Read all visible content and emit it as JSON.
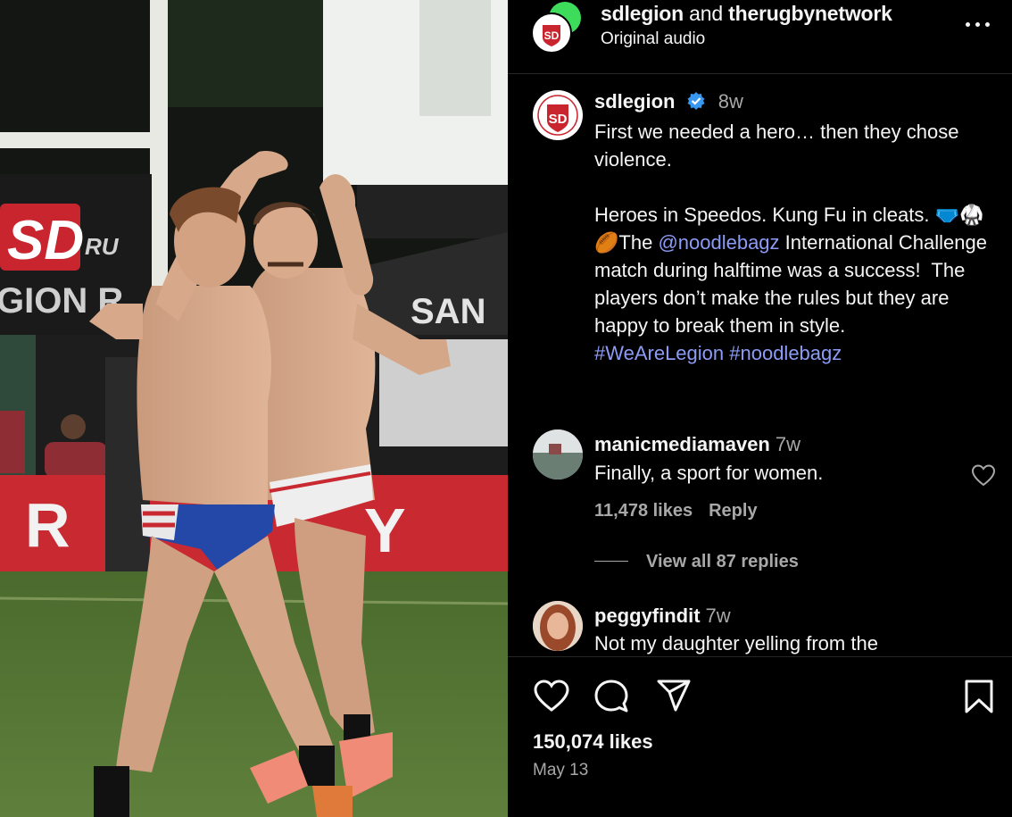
{
  "header": {
    "user1": "sdlegion",
    "and": "and",
    "user2": "therugbynetwork",
    "audio": "Original audio",
    "logo_text": "SD"
  },
  "caption": {
    "username": "sdlegion",
    "time": "8w",
    "line1": "First we needed a hero… then they chose violence.",
    "line2a": "Heroes in Speedos. Kung Fu in cleats.",
    "emoji": "🩲🥋🏉",
    "the": "The ",
    "mention": "@noodlebagz",
    "line2b": " International Challenge match during halftime was a success!  The players don’t make the rules but they are happy to break them in style.",
    "hashtags": "#WeAreLegion #noodlebagz"
  },
  "comments": [
    {
      "username": "manicmediamaven",
      "time": "7w",
      "text": "Finally, a sport for women.",
      "likes": "11,478 likes",
      "reply": "Reply",
      "view_replies": "View all 87 replies"
    },
    {
      "username": "peggyfindit",
      "time": "7w",
      "text": "Not my daughter yelling from the"
    }
  ],
  "footer": {
    "likes": "150,074 likes",
    "date": "May 13"
  },
  "media": {
    "banner_left": "SD",
    "banner_ru": "RU",
    "banner_gion": "GION R",
    "banner_san": "SAN",
    "ad_r": "R",
    "ad_y": "Y"
  }
}
